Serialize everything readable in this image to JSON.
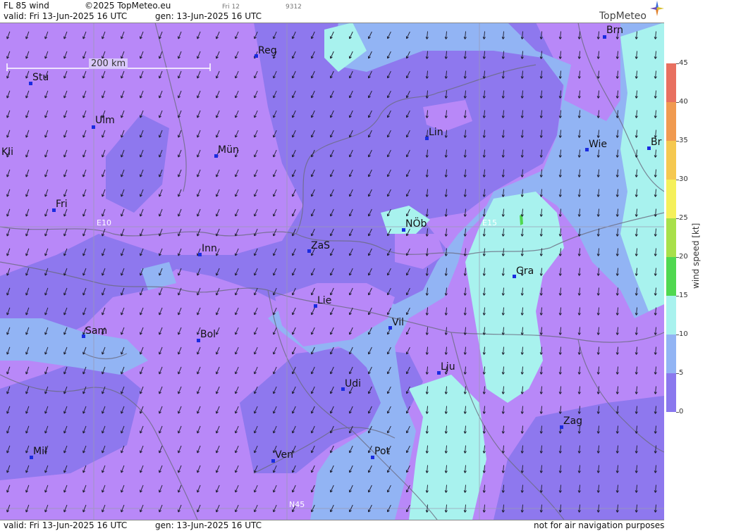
{
  "header": {
    "title": "FL 85 wind",
    "copyright": "©2025 TopMeteo.eu",
    "day_code": "Fri 12",
    "run_id": "9312",
    "valid": "valid:  Fri  13-Jun-2025  16 UTC",
    "gen": "gen: 13-Jun-2025 16 UTC",
    "brand": "TopMeteo"
  },
  "footer": {
    "valid": "valid:  Fri  13-Jun-2025  16 UTC",
    "gen": "gen: 13-Jun-2025 16 UTC",
    "disclaimer": "not for air navigation purposes"
  },
  "scale_label": "200 km",
  "grid_labels": {
    "e10": "E10",
    "e15": "E15",
    "n45": "N45"
  },
  "legend": {
    "unit": "wind speed [kt]",
    "ticks": [
      "45",
      "40",
      "35",
      "30",
      "25",
      "20",
      "15",
      "10",
      "5",
      "0"
    ],
    "colors": [
      "#e87060",
      "#f09a50",
      "#f5c850",
      "#f5f05a",
      "#a8e04a",
      "#50d850",
      "#a8f2ee",
      "#92b4f4",
      "#8a78ee",
      "#b888f8"
    ]
  },
  "cities": [
    {
      "name": "Brn"
    },
    {
      "name": "Reg"
    },
    {
      "name": "Stu"
    },
    {
      "name": "Ulm"
    },
    {
      "name": "Lin"
    },
    {
      "name": "Wie"
    },
    {
      "name": "Br"
    },
    {
      "name": "Kli"
    },
    {
      "name": "Mün"
    },
    {
      "name": "Fri"
    },
    {
      "name": "NÖb"
    },
    {
      "name": "Inn"
    },
    {
      "name": "ZaS"
    },
    {
      "name": "Gra"
    },
    {
      "name": "Lie"
    },
    {
      "name": "Vil"
    },
    {
      "name": "Sam"
    },
    {
      "name": "Bol"
    },
    {
      "name": "Lju"
    },
    {
      "name": "Udi"
    },
    {
      "name": "Zag"
    },
    {
      "name": "Mil"
    },
    {
      "name": "Pot"
    },
    {
      "name": "Ven"
    }
  ]
}
